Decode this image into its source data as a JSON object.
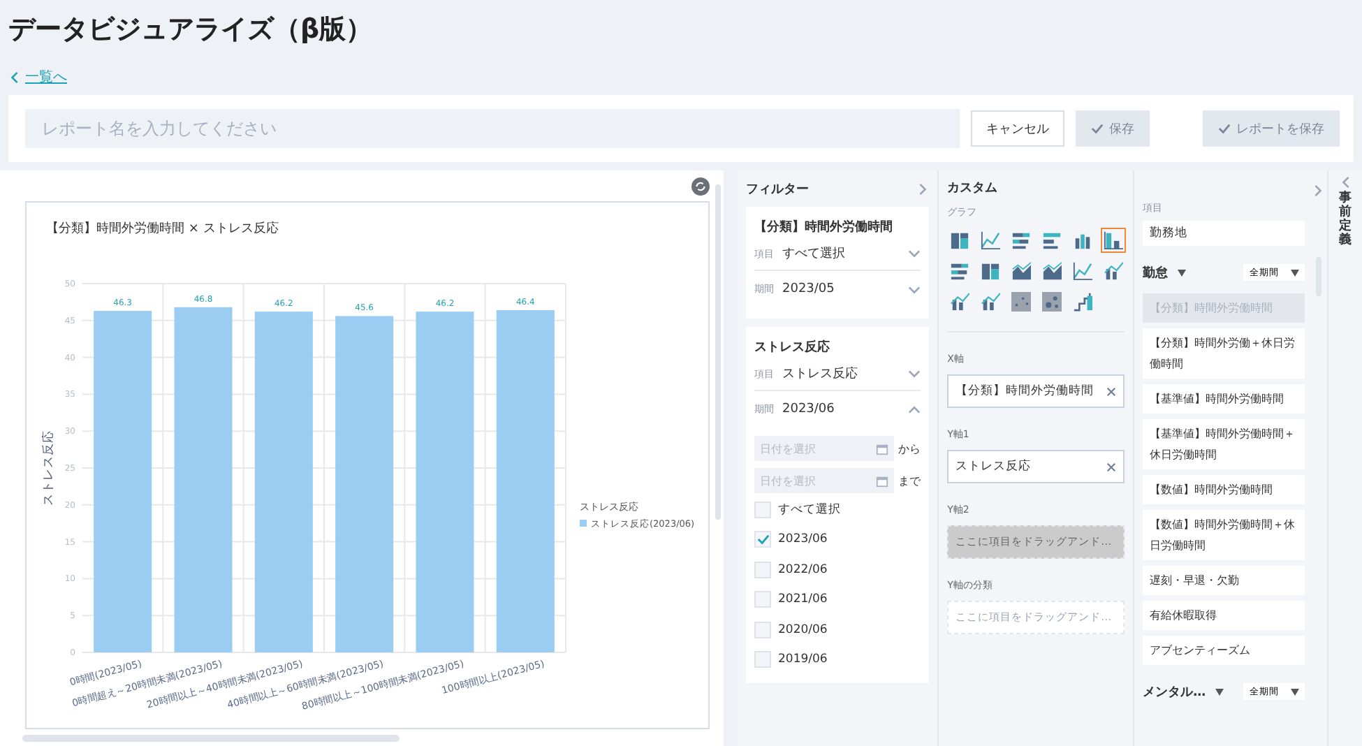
{
  "page": {
    "title": "データビジュアライズ（β版）",
    "back_link": "一覧へ"
  },
  "toolbar": {
    "report_name": {
      "placeholder": "レポート名を入力してください"
    },
    "buttons": [
      {
        "label": "キャンセル",
        "kind": "outline",
        "disabled": false
      },
      {
        "label": "保存",
        "kind": "check",
        "disabled": true
      },
      {
        "label": "レポートを保存",
        "kind": "check",
        "disabled": true
      }
    ]
  },
  "chart_panel": {
    "title": "【分類】時間外労働時間 × ストレス反応",
    "legend_title": "ストレス反応",
    "chart_data": {
      "type": "bar",
      "ylabel": "ストレス反応",
      "categories": [
        "0時間(2023/05)",
        "0時間超え～20時間未満(2023/05)",
        "20時間以上～40時間未満(2023/05)",
        "40時間以上～60時間未満(2023/05)",
        "80時間以上～100時間未満(2023/05)",
        "100時間以上(2023/05)"
      ],
      "series": [
        {
          "name": "ストレス反応(2023/06)",
          "color": "#9bcdf2",
          "values": [
            46.3,
            46.8,
            46.2,
            45.6,
            46.2,
            46.4
          ]
        }
      ],
      "grid": true,
      "ylim": [
        0,
        50
      ],
      "yticks": [
        0,
        5,
        10,
        15,
        20,
        25,
        30,
        35,
        40,
        45,
        50
      ],
      "data_labels": true
    }
  },
  "filter": {
    "title": "フィルター",
    "groups": [
      {
        "name": "【分類】時間外労働時間",
        "rows": [
          {
            "label": "項目",
            "value": "すべて選択",
            "expanded": false
          },
          {
            "label": "期間",
            "value": "2023/05",
            "expanded": false
          }
        ]
      },
      {
        "name": "ストレス反応",
        "rows": [
          {
            "label": "項目",
            "value": "ストレス反応",
            "expanded": false
          },
          {
            "label": "期間",
            "value": "2023/06",
            "expanded": true
          }
        ],
        "date_range": [
          {
            "placeholder": "日付を選択",
            "suffix": "から"
          },
          {
            "placeholder": "日付を選択",
            "suffix": "まで"
          }
        ],
        "options": [
          {
            "label": "すべて選択",
            "checked": false
          },
          {
            "label": "2023/06",
            "checked": true
          },
          {
            "label": "2022/06",
            "checked": false
          },
          {
            "label": "2021/06",
            "checked": false
          },
          {
            "label": "2020/06",
            "checked": false
          },
          {
            "label": "2019/06",
            "checked": false
          }
        ]
      }
    ]
  },
  "custom": {
    "title": "カスタム",
    "graph_label": "グラフ",
    "graph_types": [
      {
        "kind": "stacked",
        "selected": false
      },
      {
        "kind": "line",
        "selected": false
      },
      {
        "kind": "hstacked",
        "selected": false
      },
      {
        "kind": "hbar",
        "selected": false
      },
      {
        "kind": "grouped",
        "selected": false
      },
      {
        "kind": "bar",
        "selected": true
      },
      {
        "kind": "hstacked",
        "selected": false
      },
      {
        "kind": "stacked",
        "selected": false
      },
      {
        "kind": "area",
        "selected": false
      },
      {
        "kind": "area",
        "selected": false
      },
      {
        "kind": "line",
        "selected": false
      },
      {
        "kind": "combo",
        "selected": false
      },
      {
        "kind": "combo",
        "selected": false
      },
      {
        "kind": "combo",
        "selected": false
      },
      {
        "kind": "scatter",
        "selected": false
      },
      {
        "kind": "bubble",
        "selected": false
      },
      {
        "kind": "step",
        "selected": false
      }
    ],
    "axes": [
      {
        "label": "X軸",
        "value": "【分類】時間外労働時間",
        "disabled": false
      },
      {
        "label": "Y軸1",
        "value": "ストレス反応",
        "disabled": false
      },
      {
        "label": "Y軸2",
        "placeholder": "ここに項目をドラッグアンド…",
        "disabled": true
      },
      {
        "label": "Y軸の分類",
        "placeholder": "ここに項目をドラッグアンド…",
        "disabled": false
      }
    ]
  },
  "items": {
    "field_label": "項目",
    "field_value": "勤務地",
    "groups": [
      {
        "name": "勤怠",
        "period": "全期間",
        "items": [
          {
            "label": "【分類】時間外労働時間",
            "disabled": true
          },
          {
            "label": "【分類】時間外労働＋休日労働時間",
            "disabled": false
          },
          {
            "label": "【基準値】時間外労働時間",
            "disabled": false
          },
          {
            "label": "【基準値】時間外労働時間＋休日労働時間",
            "disabled": false
          },
          {
            "label": "【数値】時間外労働時間",
            "disabled": false
          },
          {
            "label": "【数値】時間外労働時間＋休日労働時間",
            "disabled": false
          },
          {
            "label": "遅刻・早退・欠勤",
            "disabled": false
          },
          {
            "label": "有給休暇取得",
            "disabled": false
          },
          {
            "label": "アブセンティーズム",
            "disabled": false
          }
        ]
      },
      {
        "name": "メンタル…",
        "period": "全期間"
      }
    ]
  },
  "side_tab": {
    "label": "事前定義"
  }
}
